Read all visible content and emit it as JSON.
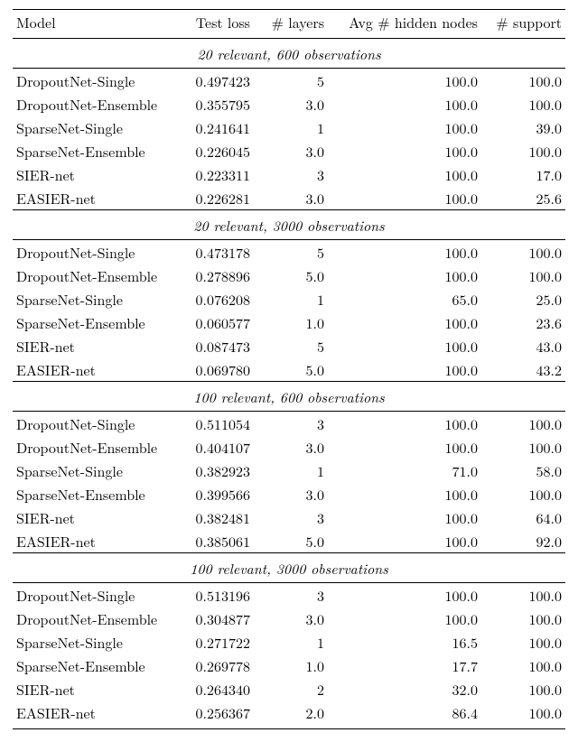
{
  "chart_data": {
    "type": "table",
    "columns": [
      "Model",
      "Test loss",
      "# layers",
      "Avg # hidden nodes",
      "# support"
    ],
    "sections": [
      {
        "title": "20 relevant, 600 observations",
        "rows": [
          {
            "model": "DropoutNet-Single",
            "loss": "0.497423",
            "layers": "5",
            "nodes": "100.0",
            "support": "100.0"
          },
          {
            "model": "DropoutNet-Ensemble",
            "loss": "0.355795",
            "layers": "3.0",
            "nodes": "100.0",
            "support": "100.0"
          },
          {
            "model": "SparseNet-Single",
            "loss": "0.241641",
            "layers": "1",
            "nodes": "100.0",
            "support": "39.0"
          },
          {
            "model": "SparseNet-Ensemble",
            "loss": "0.226045",
            "layers": "3.0",
            "nodes": "100.0",
            "support": "100.0"
          },
          {
            "model": "SIER-net",
            "loss": "0.223311",
            "layers": "3",
            "nodes": "100.0",
            "support": "17.0"
          },
          {
            "model": "EASIER-net",
            "loss": "0.226281",
            "layers": "3.0",
            "nodes": "100.0",
            "support": "25.6"
          }
        ]
      },
      {
        "title": "20 relevant, 3000 observations",
        "rows": [
          {
            "model": "DropoutNet-Single",
            "loss": "0.473178",
            "layers": "5",
            "nodes": "100.0",
            "support": "100.0"
          },
          {
            "model": "DropoutNet-Ensemble",
            "loss": "0.278896",
            "layers": "5.0",
            "nodes": "100.0",
            "support": "100.0"
          },
          {
            "model": "SparseNet-Single",
            "loss": "0.076208",
            "layers": "1",
            "nodes": "65.0",
            "support": "25.0"
          },
          {
            "model": "SparseNet-Ensemble",
            "loss": "0.060577",
            "layers": "1.0",
            "nodes": "100.0",
            "support": "23.6"
          },
          {
            "model": "SIER-net",
            "loss": "0.087473",
            "layers": "5",
            "nodes": "100.0",
            "support": "43.0"
          },
          {
            "model": "EASIER-net",
            "loss": "0.069780",
            "layers": "5.0",
            "nodes": "100.0",
            "support": "43.2"
          }
        ]
      },
      {
        "title": "100 relevant, 600 observations",
        "rows": [
          {
            "model": "DropoutNet-Single",
            "loss": "0.511054",
            "layers": "3",
            "nodes": "100.0",
            "support": "100.0"
          },
          {
            "model": "DropoutNet-Ensemble",
            "loss": "0.404107",
            "layers": "3.0",
            "nodes": "100.0",
            "support": "100.0"
          },
          {
            "model": "SparseNet-Single",
            "loss": "0.382923",
            "layers": "1",
            "nodes": "71.0",
            "support": "58.0"
          },
          {
            "model": "SparseNet-Ensemble",
            "loss": "0.399566",
            "layers": "3.0",
            "nodes": "100.0",
            "support": "100.0"
          },
          {
            "model": "SIER-net",
            "loss": "0.382481",
            "layers": "3",
            "nodes": "100.0",
            "support": "64.0"
          },
          {
            "model": "EASIER-net",
            "loss": "0.385061",
            "layers": "5.0",
            "nodes": "100.0",
            "support": "92.0"
          }
        ]
      },
      {
        "title": "100 relevant, 3000 observations",
        "rows": [
          {
            "model": "DropoutNet-Single",
            "loss": "0.513196",
            "layers": "3",
            "nodes": "100.0",
            "support": "100.0"
          },
          {
            "model": "DropoutNet-Ensemble",
            "loss": "0.304877",
            "layers": "3.0",
            "nodes": "100.0",
            "support": "100.0"
          },
          {
            "model": "SparseNet-Single",
            "loss": "0.271722",
            "layers": "1",
            "nodes": "16.5",
            "support": "100.0"
          },
          {
            "model": "SparseNet-Ensemble",
            "loss": "0.269778",
            "layers": "1.0",
            "nodes": "17.7",
            "support": "100.0"
          },
          {
            "model": "SIER-net",
            "loss": "0.264340",
            "layers": "2",
            "nodes": "32.0",
            "support": "100.0"
          },
          {
            "model": "EASIER-net",
            "loss": "0.256367",
            "layers": "2.0",
            "nodes": "86.4",
            "support": "100.0"
          }
        ]
      }
    ]
  }
}
